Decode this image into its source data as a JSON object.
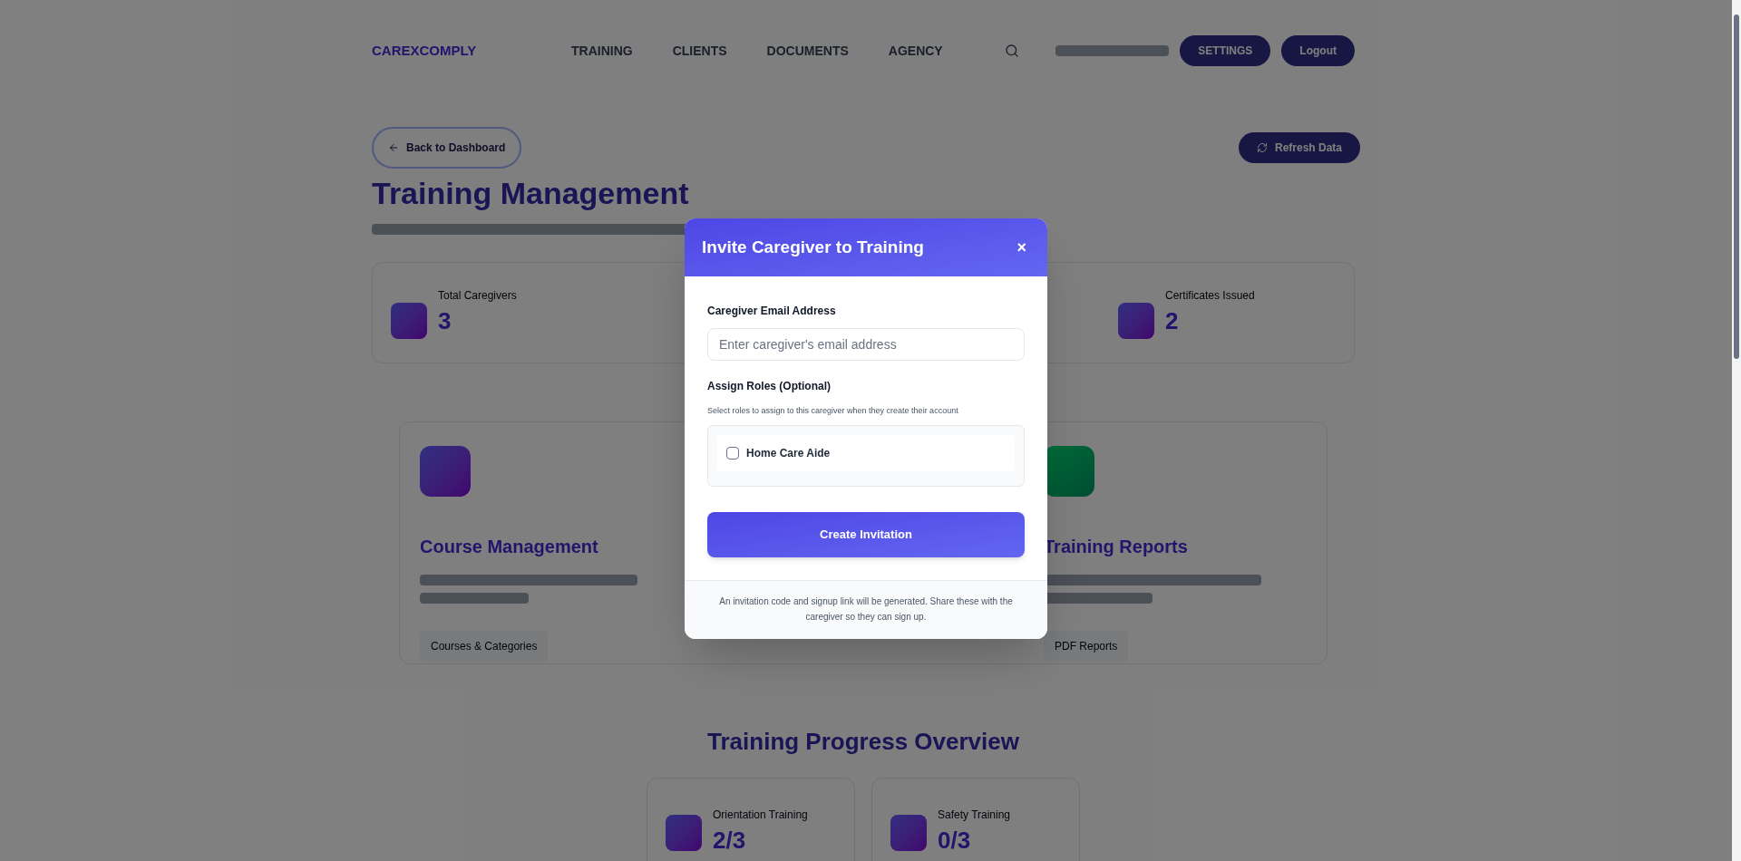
{
  "header": {
    "logo": "CAREXCOMPLY",
    "nav": [
      "TRAINING",
      "CLIENTS",
      "DOCUMENTS",
      "AGENCY"
    ],
    "buttons": [
      "SETTINGS",
      "Logout"
    ]
  },
  "page": {
    "back_button": "Back to Dashboard",
    "refresh_button": "Refresh Data",
    "title": "Training Management",
    "stats": [
      {
        "label": "Total Caregivers",
        "value": "3"
      },
      {
        "label": "Certificates Issued",
        "value": "2"
      }
    ],
    "features": [
      {
        "title": "Course Management",
        "tag": "Courses & Categories"
      },
      {
        "title": "Training Reports",
        "tag": "PDF Reports"
      }
    ],
    "progress_title": "Training Progress Overview",
    "progress": [
      {
        "label": "Orientation Training",
        "value": "2/3"
      },
      {
        "label": "Safety Training",
        "value": "0/3"
      }
    ]
  },
  "modal": {
    "title": "Invite Caregiver to Training",
    "close": "×",
    "email_label": "Caregiver Email Address",
    "email_placeholder": "Enter caregiver's email address",
    "roles_label": "Assign Roles (Optional)",
    "roles_hint": "Select roles to assign to this caregiver when they create their account",
    "roles": [
      {
        "label": "Home Care Aide",
        "checked": false
      }
    ],
    "submit": "Create Invitation",
    "note": "An invitation code and signup link will be generated. Share these with the caregiver so they can sign up."
  }
}
